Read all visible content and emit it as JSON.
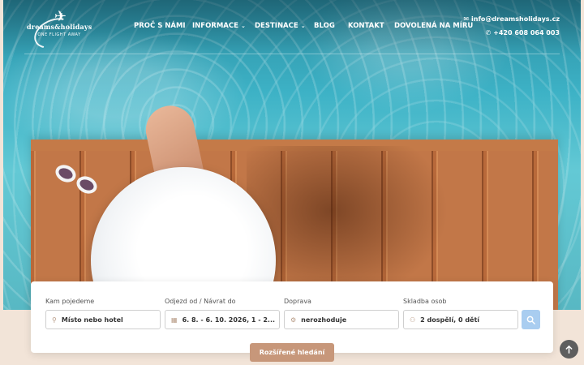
{
  "logo": {
    "name": "dreams&holidays",
    "tagline": "ONE FLIGHT AWAY"
  },
  "nav": {
    "items": [
      {
        "label": "PROČ S NÁMI",
        "dropdown": false
      },
      {
        "label": "INFORMACE",
        "dropdown": true
      },
      {
        "label": "DESTINACE",
        "dropdown": true
      },
      {
        "label": "BLOG",
        "dropdown": false
      },
      {
        "label": "KONTAKT",
        "dropdown": false
      },
      {
        "label": "DOVOLENÁ NA MÍRU",
        "dropdown": false
      }
    ]
  },
  "contact": {
    "email": "info@dreamsholidays.cz",
    "phone": "+420 608 064 003",
    "email_icon": "envelope-icon",
    "phone_icon": "phone-icon"
  },
  "search": {
    "destination": {
      "label": "Kam pojedeme",
      "value": "Místo nebo hotel",
      "icon": "map-pin-icon"
    },
    "dates": {
      "label": "Odjezd od / Návrat do",
      "value": "6. 8. - 6. 10. 2026, 1 - 2...",
      "icon": "calendar-icon"
    },
    "transport": {
      "label": "Doprava",
      "value": "nerozhoduje",
      "icon": "transport-icon"
    },
    "travelers": {
      "label": "Skladba osob",
      "value": "2 dospělí, 0 dětí",
      "icon": "people-icon"
    },
    "submit_icon": "search-icon",
    "advanced_label": "Rozšířené hledání"
  },
  "colors": {
    "accent": "#c7977a",
    "search_button": "#a9cdf0"
  }
}
